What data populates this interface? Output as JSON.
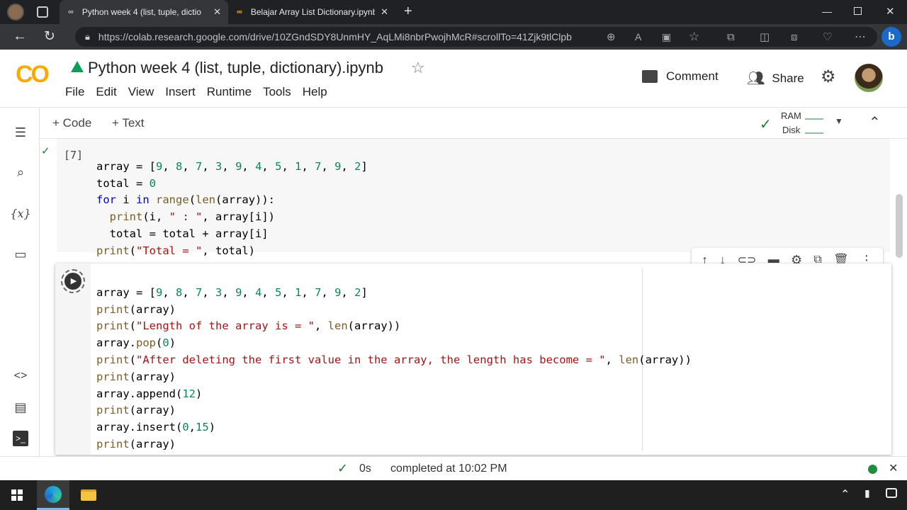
{
  "browser": {
    "tabs": [
      {
        "label": "Python week 4 (list, tuple, dictio",
        "active": true
      },
      {
        "label": "Belajar Array List Dictionary.ipynb",
        "active": false
      }
    ],
    "url": "https://colab.research.google.com/drive/10ZGndSDY8UnmHY_AqLMi8nbrPwojhMcR#scrollTo=41Zjk9tlClpb"
  },
  "notebook": {
    "title": "Python week 4 (list, tuple, dictionary).ipynb",
    "logo": "CO",
    "menu": [
      "File",
      "Edit",
      "View",
      "Insert",
      "Runtime",
      "Tools",
      "Help"
    ],
    "comment_label": "Comment",
    "share_label": "Share",
    "add_code_label": "+ Code",
    "add_text_label": "+ Text",
    "ram_label": "RAM",
    "disk_label": "Disk"
  },
  "cells": {
    "cell1": {
      "exec_count": "[7]",
      "lines": [
        "array = [9, 8, 7, 3, 9, 4, 5, 1, 7, 9, 2]",
        "total = 0",
        "for i in range(len(array)):",
        "  print(i, \" : \", array[i])",
        "  total = total + array[i]",
        "print(\"Total = \", total)"
      ]
    },
    "cell2": {
      "lines": [
        "array = [9, 8, 7, 3, 9, 4, 5, 1, 7, 9, 2]",
        "print(array)",
        "print(\"Length of the array is = \", len(array))",
        "array.pop(0)",
        "print(\"After deleting the first value in the array, the length has become = \", len(array))",
        "print(array)",
        "array.append(12)",
        "print(array)",
        "array.insert(0,15)",
        "print(array)"
      ]
    }
  },
  "status": {
    "duration": "0s",
    "message": "completed at 10:02 PM"
  },
  "colors": {
    "accent_orange": "#f9ab00",
    "keyword": "#0000c0",
    "string": "#a31515",
    "number": "#098658",
    "builtin": "#795e26",
    "check_green": "#188038"
  }
}
